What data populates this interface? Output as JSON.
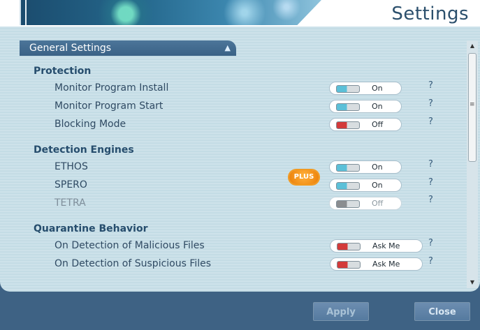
{
  "window": {
    "title": "Settings"
  },
  "section": {
    "label": "General Settings",
    "collapse_icon": "triangle-up-icon"
  },
  "groups": [
    {
      "title": "Protection",
      "options": [
        {
          "label": "Monitor Program Install",
          "state": "On",
          "help": "?"
        },
        {
          "label": "Monitor Program Start",
          "state": "On",
          "help": "?"
        },
        {
          "label": "Blocking Mode",
          "state": "Off",
          "help": "?"
        }
      ]
    },
    {
      "title": "Detection Engines",
      "options": [
        {
          "label": "ETHOS",
          "state": "On",
          "help": "?"
        },
        {
          "label": "SPERO",
          "state": "On",
          "help": "?"
        },
        {
          "label": "TETRA",
          "state": "Off",
          "help": "?",
          "badge": "PLUS"
        }
      ]
    },
    {
      "title": "Quarantine Behavior",
      "options": [
        {
          "label": "On Detection of Malicious Files",
          "state": "Ask Me",
          "help": "?"
        },
        {
          "label": "On Detection of Suspicious Files",
          "state": "Ask Me",
          "help": "?"
        }
      ]
    }
  ],
  "footer": {
    "apply_label": "Apply",
    "close_label": "Close"
  },
  "colors": {
    "accent": "#3a6286",
    "on": "#5cc0d8",
    "off": "#d33a3a",
    "badge": "#ea7d06"
  }
}
